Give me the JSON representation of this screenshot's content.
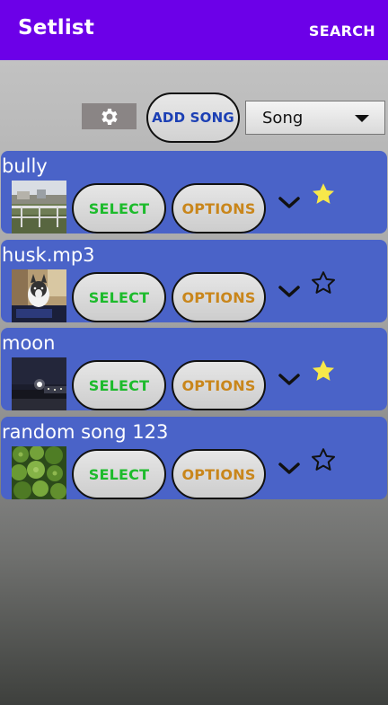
{
  "appbar": {
    "title": "Setlist",
    "search_label": "SEARCH"
  },
  "toolbar": {
    "settings_icon": "gear-icon",
    "add_song_label": "ADD SONG",
    "sort_value": "Song"
  },
  "songs": [
    {
      "name": "bully",
      "select_label": "SELECT",
      "options_label": "OPTIONS",
      "favorite": true,
      "thumbnail": "railing-landscape"
    },
    {
      "name": "husk.mp3",
      "select_label": "SELECT",
      "options_label": "OPTIONS",
      "favorite": false,
      "thumbnail": "dog-on-couch"
    },
    {
      "name": "moon",
      "select_label": "SELECT",
      "options_label": "OPTIONS",
      "favorite": true,
      "thumbnail": "night-sky"
    },
    {
      "name": "random song 123",
      "select_label": "SELECT",
      "options_label": "OPTIONS",
      "favorite": false,
      "thumbnail": "broccoli"
    }
  ],
  "colors": {
    "appbar": "#6c00e8",
    "card": "#4a63c8",
    "select_text": "#1dbb2c",
    "options_text": "#c9861b",
    "add_song_text": "#1b3fb4",
    "star_filled": "#f7e84a"
  }
}
